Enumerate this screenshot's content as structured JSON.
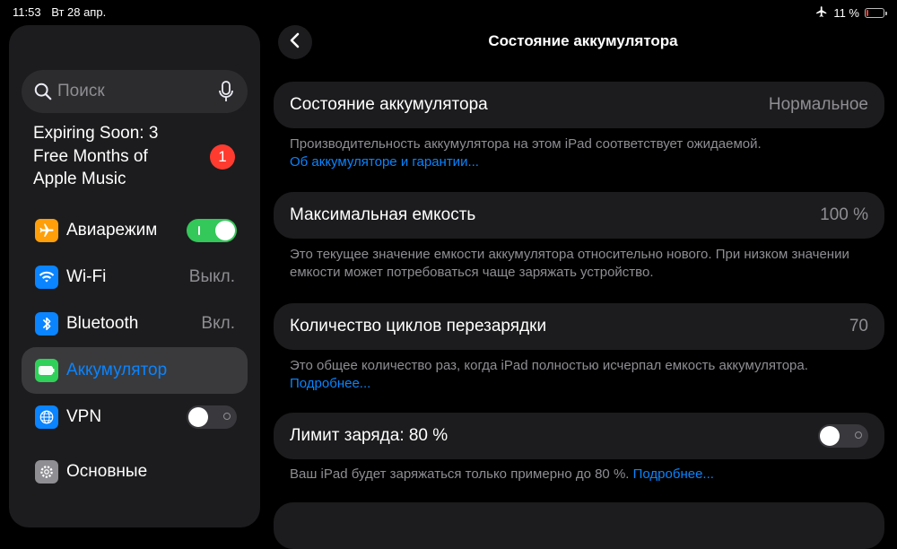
{
  "status_bar": {
    "time": "11:53",
    "date": "Вт 28 апр.",
    "battery_percent": "11 %",
    "battery_level": 0.11,
    "icons": [
      "airplane-icon",
      "battery-icon"
    ]
  },
  "sidebar": {
    "search": {
      "placeholder": "Поиск"
    },
    "promo": {
      "line1": "Expiring Soon: 3",
      "line2": "Free Months of",
      "line3": "Apple Music",
      "badge": "1"
    },
    "items": [
      {
        "label": "Авиарежим",
        "icon": "airplane-icon",
        "color": "#ff9f0a",
        "toggle": "on"
      },
      {
        "label": "Wi‑Fi",
        "value": "Выкл.",
        "icon": "wifi-icon",
        "color": "#0a84ff"
      },
      {
        "label": "Bluetooth",
        "value": "Вкл.",
        "icon": "bluetooth-icon",
        "color": "#0a84ff"
      },
      {
        "label": "Аккумулятор",
        "icon": "battery-icon",
        "color": "#30d158",
        "selected": true
      },
      {
        "label": "VPN",
        "icon": "globe-icon",
        "color": "#0a84ff",
        "toggle": "off"
      },
      {
        "label": "Основные",
        "icon": "gear-icon",
        "color": "#8e8e93"
      }
    ]
  },
  "main": {
    "title": "Состояние аккумулятора",
    "rows": [
      {
        "label": "Состояние аккумулятора",
        "value": "Нормальное",
        "footnote": "Производительность аккумулятора на этом iPad соответствует ожидаемой.",
        "link": "Об аккумуляторе и гарантии..."
      },
      {
        "label": "Максимальная емкость",
        "value": "100 %",
        "footnote": "Это текущее значение емкости аккумулятора относительно нового. При низком значении емкости может потребоваться чаще заряжать устройство."
      },
      {
        "label": "Количество циклов перезарядки",
        "value": "70",
        "footnote": "Это общее количество раз, когда iPad полностью исчерпал емкость аккумулятора.",
        "link": "Подробнее..."
      },
      {
        "label": "Лимит заряда: 80 %",
        "toggle": "off",
        "footnote": "Ваш iPad будет заряжаться только примерно до 80 %.",
        "link": "Подробнее..."
      }
    ]
  },
  "colors": {
    "accent": "#0a84ff",
    "toggle_on": "#34c759",
    "badge": "#ff3b30"
  }
}
